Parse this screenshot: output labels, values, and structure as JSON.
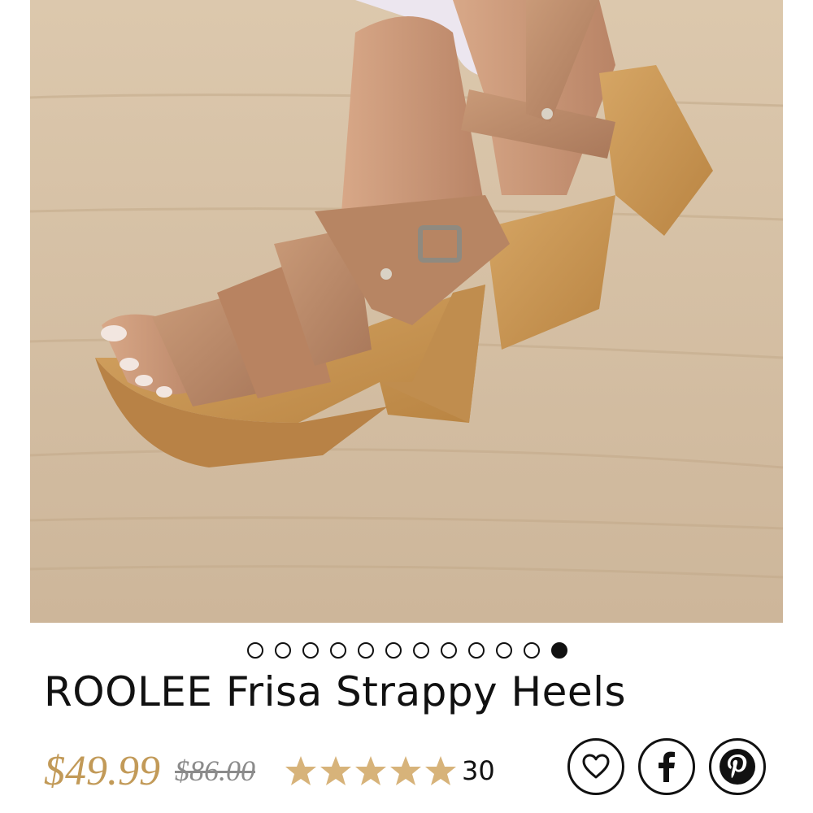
{
  "product": {
    "title": "ROOLEE Frisa Strappy Heels",
    "price": "$49.99",
    "compare_price": "$86.00",
    "rating": 5,
    "review_count": "30",
    "image_alt": "tan leather strappy platform heels on a stone floor"
  },
  "carousel": {
    "total_slides": 12,
    "active_index": 11
  },
  "share": {
    "wishlist_icon": "heart-icon",
    "facebook_icon": "facebook-icon",
    "pinterest_icon": "pinterest-icon"
  },
  "colors": {
    "price": "#c29a58",
    "star": "#d7b37a",
    "compare": "#8b8b8b",
    "text": "#111111"
  }
}
